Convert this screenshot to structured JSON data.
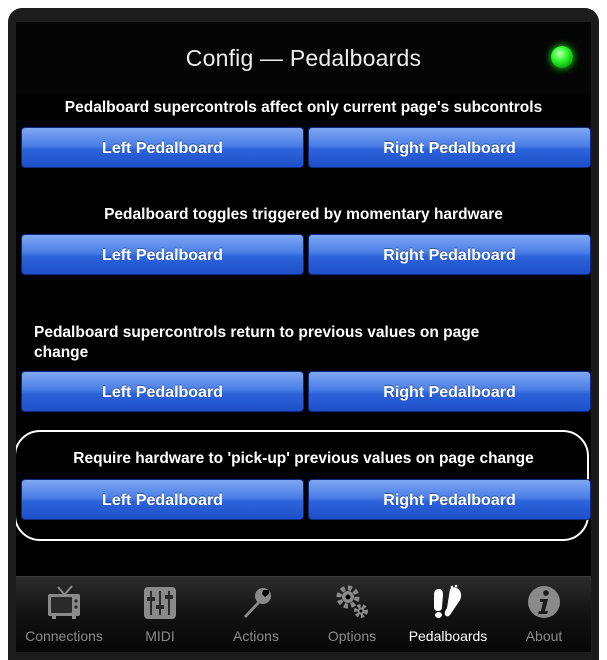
{
  "header": {
    "title": "Config — Pedalboards",
    "status_led_color": "#22dd22"
  },
  "sections": [
    {
      "label": "Pedalboard supercontrols affect only current page's subcontrols",
      "left": "Left Pedalboard",
      "right": "Right Pedalboard"
    },
    {
      "label": "Pedalboard toggles triggered by momentary hardware",
      "left": "Left Pedalboard",
      "right": "Right Pedalboard"
    },
    {
      "label_line1": "Pedalboard supercontrols return to previous values on page",
      "label_line2": "change",
      "left": "Left Pedalboard",
      "right": "Right Pedalboard"
    },
    {
      "label": "Require hardware to 'pick-up' previous values on page change",
      "left": "Left Pedalboard",
      "right": "Right Pedalboard"
    }
  ],
  "tabbar": {
    "tabs": [
      {
        "label": "Connections",
        "icon": "tv-icon"
      },
      {
        "label": "MIDI",
        "icon": "mixer-icon"
      },
      {
        "label": "Actions",
        "icon": "wrench-icon"
      },
      {
        "label": "Options",
        "icon": "gears-icon"
      },
      {
        "label": "Pedalboards",
        "icon": "footprint-icon"
      },
      {
        "label": "About",
        "icon": "info-icon"
      }
    ],
    "active": "Pedalboards"
  },
  "colors": {
    "button_top": "#7fa8f2",
    "button_bottom": "#1e50c9",
    "background": "#000000"
  }
}
